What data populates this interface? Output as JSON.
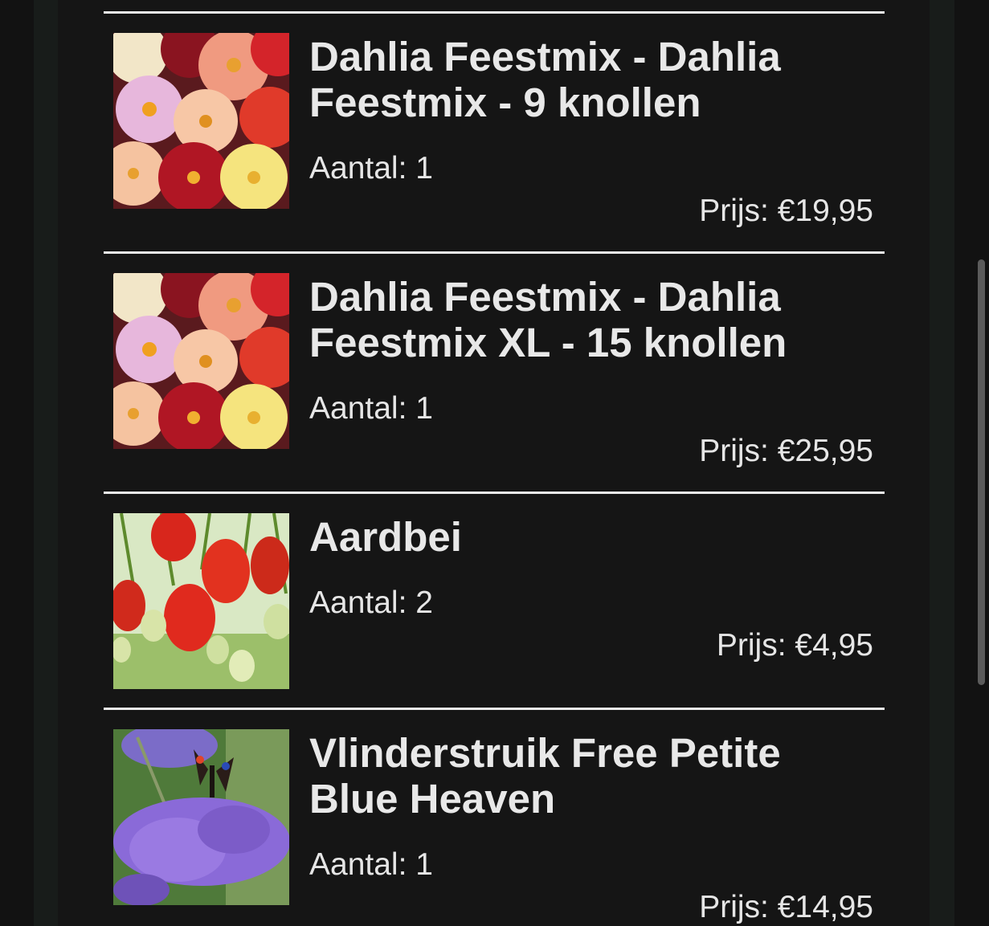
{
  "cart": {
    "items": [
      {
        "title": "Dahlia Feestmix - Dahlia Feestmix - 9 knollen",
        "quantity_text": "Aantal: 1",
        "price_text": "Prijs: €19,95",
        "image": "dahlia-mix-photo"
      },
      {
        "title": "Dahlia Feestmix - Dahlia Feestmix XL - 15 knollen",
        "quantity_text": "Aantal: 1",
        "price_text": "Prijs: €25,95",
        "image": "dahlia-mix-photo"
      },
      {
        "title": "Aardbei",
        "quantity_text": "Aantal: 2",
        "price_text": "Prijs: €4,95",
        "image": "strawberry-photo"
      },
      {
        "title": "Vlinderstruik Free Petite Blue Heaven",
        "quantity_text": "Aantal: 1",
        "price_text": "Prijs: €14,95",
        "image": "butterfly-bush-photo"
      }
    ]
  },
  "colors": {
    "background": "#121212",
    "text": "#e8e8e8",
    "divider": "#ededed"
  }
}
